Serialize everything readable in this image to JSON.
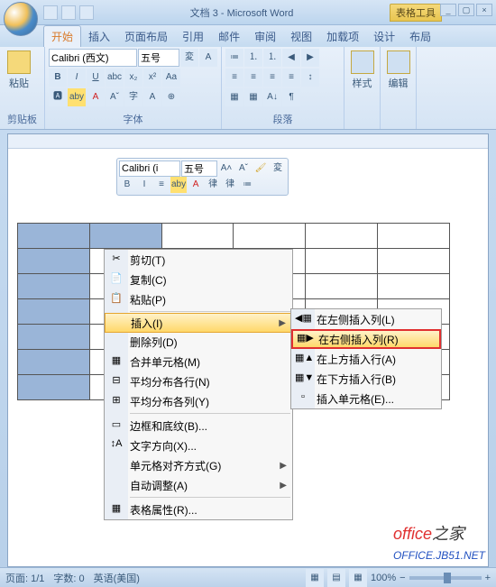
{
  "title": "文档 3 - Microsoft Word",
  "tool_context": "表格工具",
  "tabs": [
    "开始",
    "插入",
    "页面布局",
    "引用",
    "邮件",
    "审阅",
    "视图",
    "加载项",
    "设计",
    "布局"
  ],
  "active_tab": "开始",
  "ribbon_groups": {
    "clipboard": "剪贴板",
    "font": "字体",
    "paragraph": "段落",
    "styleslbl": "样式",
    "editlbl": "编辑",
    "paste": "粘贴"
  },
  "font_name": "Calibri (西文)",
  "font_size": "五号",
  "mini_font": "Calibri (i",
  "mini_size": "五号",
  "mini_row2": [
    "B",
    "I",
    "≡",
    "aby",
    "A",
    "▾",
    "律",
    "律",
    "▾"
  ],
  "ctx_menu": [
    {
      "icon": "✂",
      "label": "剪切(T)"
    },
    {
      "icon": "📄",
      "label": "复制(C)"
    },
    {
      "icon": "📋",
      "label": "粘贴(P)"
    },
    {
      "sep": true
    },
    {
      "icon": "",
      "label": "插入(I)",
      "submenu": true,
      "hl": true
    },
    {
      "icon": "",
      "label": "删除列(D)"
    },
    {
      "icon": "▦",
      "label": "合并单元格(M)"
    },
    {
      "icon": "⊟",
      "label": "平均分布各行(N)"
    },
    {
      "icon": "⊞",
      "label": "平均分布各列(Y)"
    },
    {
      "sep": true
    },
    {
      "icon": "▭",
      "label": "边框和底纹(B)..."
    },
    {
      "icon": "↕A",
      "label": "文字方向(X)..."
    },
    {
      "icon": "",
      "label": "单元格对齐方式(G)",
      "submenu": true
    },
    {
      "icon": "",
      "label": "自动调整(A)",
      "submenu": true
    },
    {
      "sep": true
    },
    {
      "icon": "▦",
      "label": "表格属性(R)..."
    }
  ],
  "sub_menu": [
    {
      "icon": "◀▦",
      "label": "在左侧插入列(L)"
    },
    {
      "icon": "▦▶",
      "label": "在右侧插入列(R)",
      "hl": true
    },
    {
      "icon": "▦▲",
      "label": "在上方插入行(A)"
    },
    {
      "icon": "▦▼",
      "label": "在下方插入行(B)"
    },
    {
      "icon": "▫",
      "label": "插入单元格(E)..."
    }
  ],
  "status": {
    "page": "页面: 1/1",
    "words": "字数: 0",
    "lang": "英语(美国)",
    "zoom": "100%"
  },
  "watermark": {
    "a": "office",
    "b": "之家",
    "c": "OFFICE.JB51.NET"
  }
}
